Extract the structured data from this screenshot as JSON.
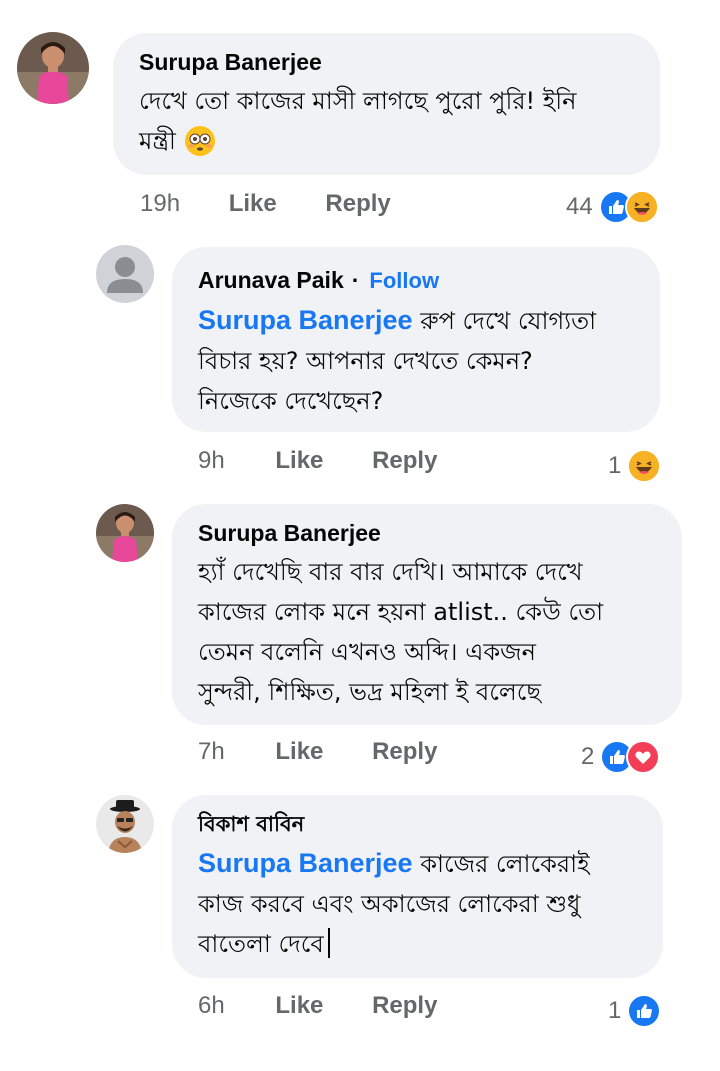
{
  "comments": [
    {
      "author": "Surupa Banerjee",
      "lines": [
        "দেখে তো কাজের মাসী লাগছে পুরো পুরি! ইনি",
        "মন্ত্রী"
      ],
      "trailing_emoji": "flushed-face",
      "time": "19h",
      "like_label": "Like",
      "reply_label": "Reply",
      "reaction_count": "44",
      "reaction_icons": [
        "like",
        "haha"
      ]
    },
    {
      "author": "Arunava Paik",
      "separator": "·",
      "follow_label": "Follow",
      "mention": "Surupa Banerjee",
      "lines": [
        "রুপ দেখে যোগ্যতা",
        "বিচার হয়? আপনার দেখতে কেমন?",
        "নিজেকে দেখেছেন?"
      ],
      "time": "9h",
      "like_label": "Like",
      "reply_label": "Reply",
      "reaction_count": "1",
      "reaction_icons": [
        "haha"
      ]
    },
    {
      "author": "Surupa Banerjee",
      "lines": [
        "হ্যাঁ দেখেছি বার বার দেখি। আমাকে দেখে",
        "কাজের লোক মনে হয়না atlist.. কেউ তো",
        "তেমন বলেনি এখনও অব্দি। একজন",
        "সুন্দরী, শিক্ষিত, ভদ্র মহিলা ই বলেছে"
      ],
      "time": "7h",
      "like_label": "Like",
      "reply_label": "Reply",
      "reaction_count": "2",
      "reaction_icons": [
        "like",
        "love"
      ]
    },
    {
      "author": "বিকাশ বাবিন",
      "mention": "Surupa Banerjee",
      "lines": [
        "কাজের লোকেরাই",
        "কাজ করবে এবং অকাজের লোকেরা শুধু",
        "বাতেলা দেবে"
      ],
      "time": "6h",
      "like_label": "Like",
      "reply_label": "Reply",
      "reaction_count": "1",
      "reaction_icons": [
        "like"
      ]
    }
  ],
  "colors": {
    "bubble": "#f0f2f5",
    "link": "#1877f2",
    "meta": "#65676b",
    "like": "#1877f2",
    "love": "#f33e58",
    "haha": "#f7b125"
  }
}
